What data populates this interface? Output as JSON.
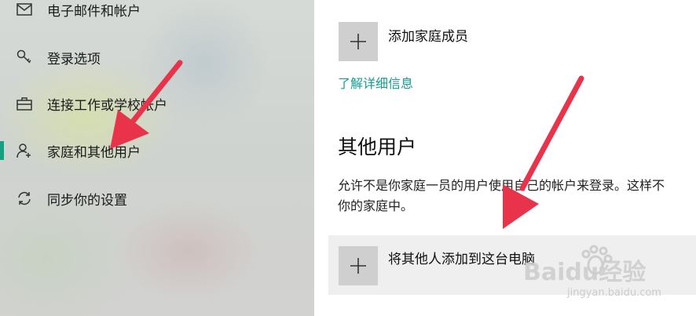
{
  "sidebar": {
    "items": [
      {
        "label": "电子邮件和帐户",
        "icon": "mail-icon",
        "selected": false
      },
      {
        "label": "登录选项",
        "icon": "key-icon",
        "selected": false
      },
      {
        "label": "连接工作或学校帐户",
        "icon": "briefcase-icon",
        "selected": false
      },
      {
        "label": "家庭和其他用户",
        "icon": "person-add-icon",
        "selected": true
      },
      {
        "label": "同步你的设置",
        "icon": "sync-icon",
        "selected": false
      }
    ]
  },
  "family": {
    "add_member_label": "添加家庭成员",
    "learn_more_link": "了解详细信息"
  },
  "other_users": {
    "title": "其他用户",
    "description_line1": "允许不是你家庭一员的用户使用自己的帐户来登录。这样不",
    "description_line2": "你的家庭中。",
    "add_other_label": "将其他人添加到这台电脑"
  },
  "watermark": {
    "brand": "Baidu经验",
    "url": "jingyan.baidu.com"
  },
  "colors": {
    "accent": "#10a37f",
    "link": "#139e8e",
    "arrow": "#e8334a",
    "tile": "#cfcfcf"
  }
}
